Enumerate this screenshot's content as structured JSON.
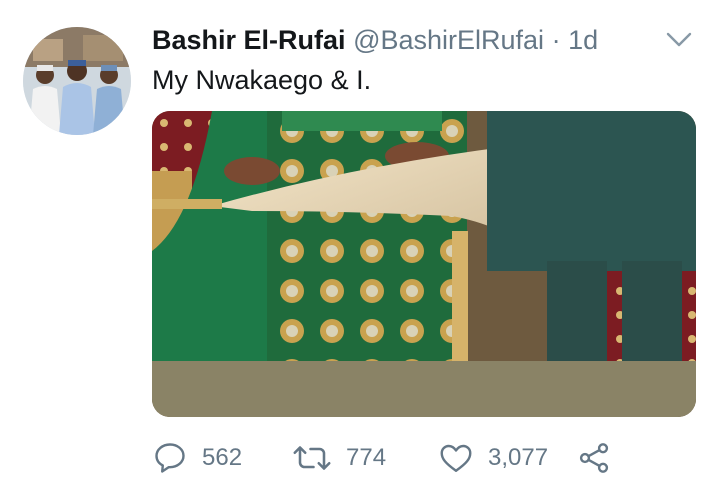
{
  "tweet": {
    "author_name": "Bashir El-Rufai",
    "handle": "@BashirElRufai",
    "separator": "·",
    "timestamp": "1d",
    "text": "My Nwakaego & I."
  },
  "actions": {
    "replies": "562",
    "retweets": "774",
    "likes": "3,077"
  },
  "icons": {
    "reply": "reply-icon",
    "retweet": "retweet-icon",
    "like": "heart-icon",
    "share": "share-icon",
    "menu": "chevron-down-icon"
  },
  "colors": {
    "text_primary": "#14171a",
    "text_secondary": "#657786",
    "background": "#ffffff"
  }
}
